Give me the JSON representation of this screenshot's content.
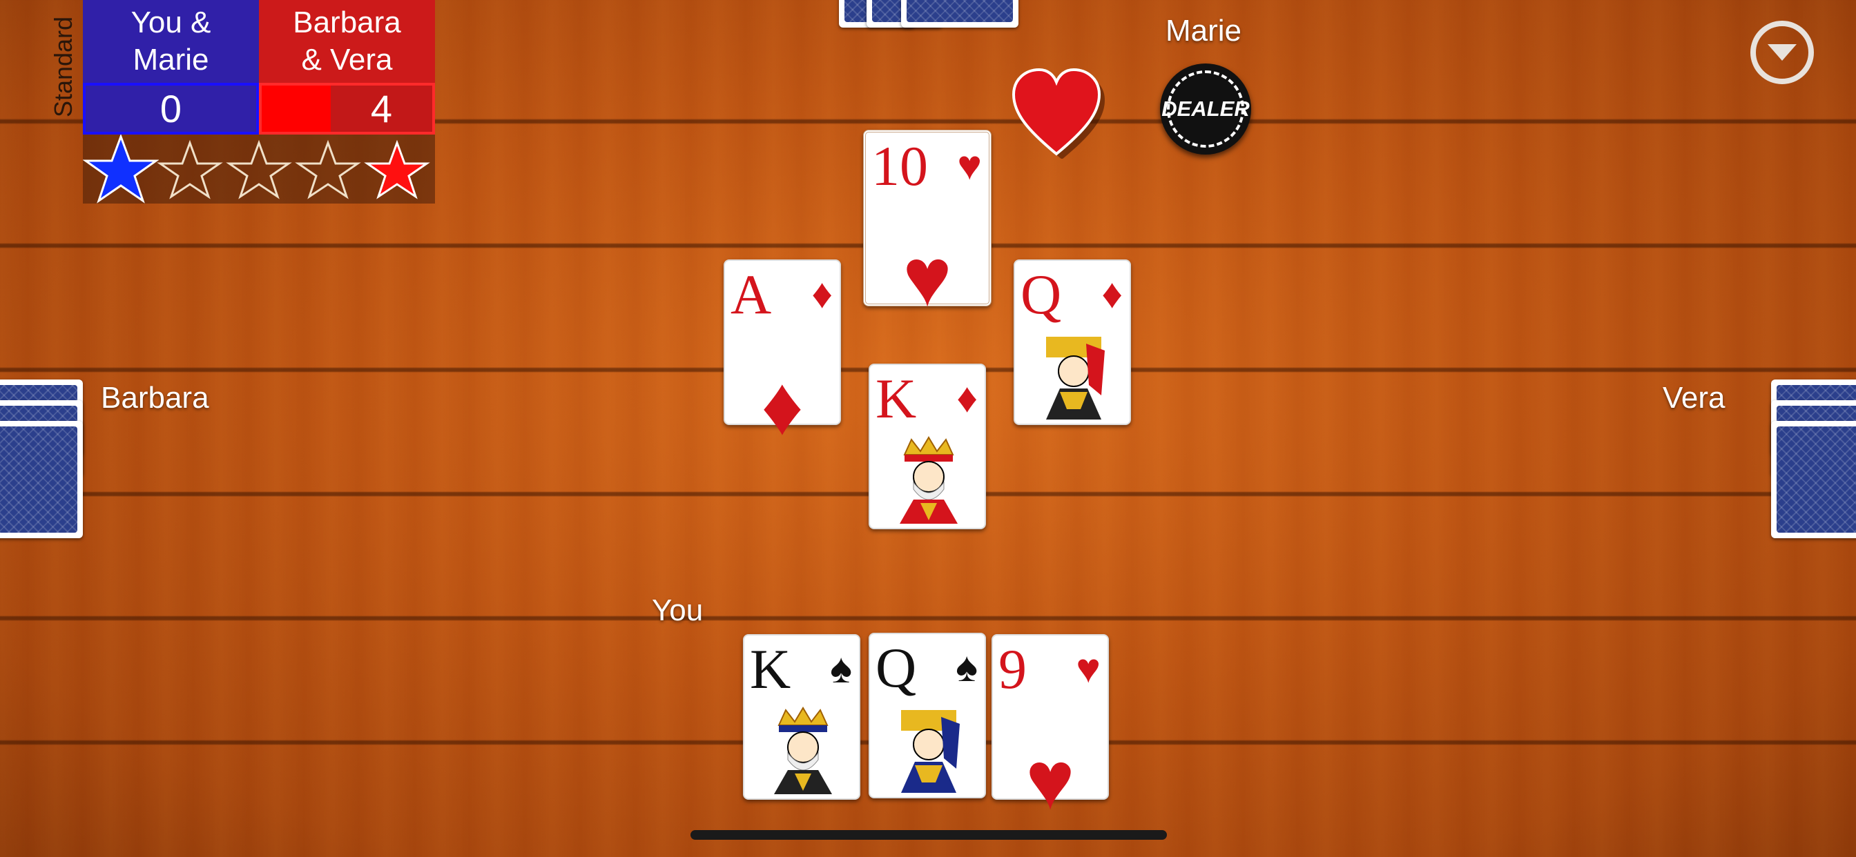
{
  "mode": "Standard",
  "teams": {
    "blue": {
      "name_line1": "You &",
      "name_line2": "Marie",
      "score": "0",
      "color": "#3020a8"
    },
    "red": {
      "name_line1": "Barbara",
      "name_line2": "& Vera",
      "score": "4",
      "color": "#cc1a1a"
    }
  },
  "stars": {
    "total": 5,
    "blue_filled": 1,
    "red_filled": 1
  },
  "players": {
    "top": "Marie",
    "left": "Barbara",
    "right": "Vera",
    "bottom": "You"
  },
  "dealer_chip": "DEALER",
  "trump_suit_icon": "heart-icon",
  "trick": {
    "top": {
      "rank": "10",
      "suit": "♥",
      "color": "red"
    },
    "left": {
      "rank": "A",
      "suit": "♦",
      "color": "red"
    },
    "right": {
      "rank": "Q",
      "suit": "♦",
      "color": "red"
    },
    "bottom": {
      "rank": "K",
      "suit": "♦",
      "color": "red"
    }
  },
  "hand": [
    {
      "rank": "K",
      "suit": "♠",
      "color": "black"
    },
    {
      "rank": "Q",
      "suit": "♠",
      "color": "black"
    },
    {
      "rank": "9",
      "suit": "♥",
      "color": "red"
    }
  ],
  "menu_icon": "chevron-down-icon"
}
